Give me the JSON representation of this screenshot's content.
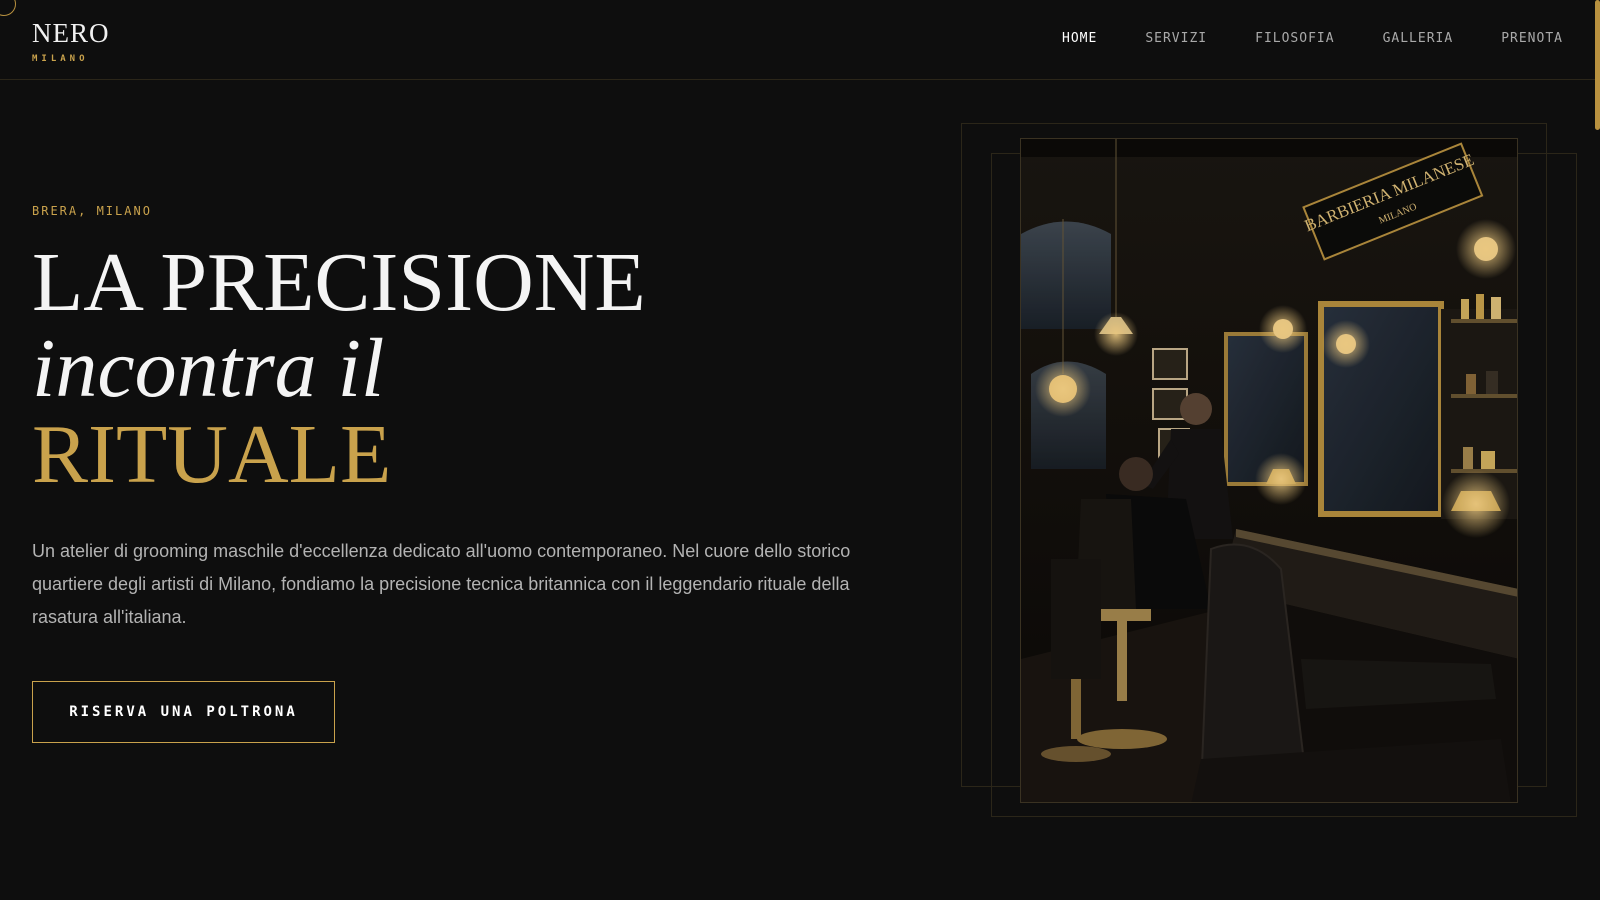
{
  "header": {
    "logo": {
      "name": "NERO",
      "sub": "MILANO"
    },
    "nav": [
      {
        "label": "HOME",
        "active": true
      },
      {
        "label": "SERVIZI",
        "active": false
      },
      {
        "label": "FILOSOFIA",
        "active": false
      },
      {
        "label": "GALLERIA",
        "active": false
      },
      {
        "label": "PRENOTA",
        "active": false
      }
    ]
  },
  "hero": {
    "location": "BRERA, MILANO",
    "headline": {
      "line1": "LA PRECISIONE",
      "line2": "incontra il",
      "line3": "RITUALE"
    },
    "description": "Un atelier di grooming maschile d'eccellenza dedicato all'uomo contemporaneo. Nel cuore dello storico quartiere degli artisti di Milano, fondiamo la precisione tecnica britannica con il leggendario rituale della rasatura all'italiana.",
    "cta_label": "RISERVA UNA POLTRONA"
  },
  "photo": {
    "sign_title": "BARBIERIA MILANESE",
    "sign_sub": "MILANO"
  },
  "colors": {
    "background": "#0e0e0e",
    "accent": "#c9a24c",
    "text": "#f4f4f4",
    "muted": "#b3b3b3"
  }
}
